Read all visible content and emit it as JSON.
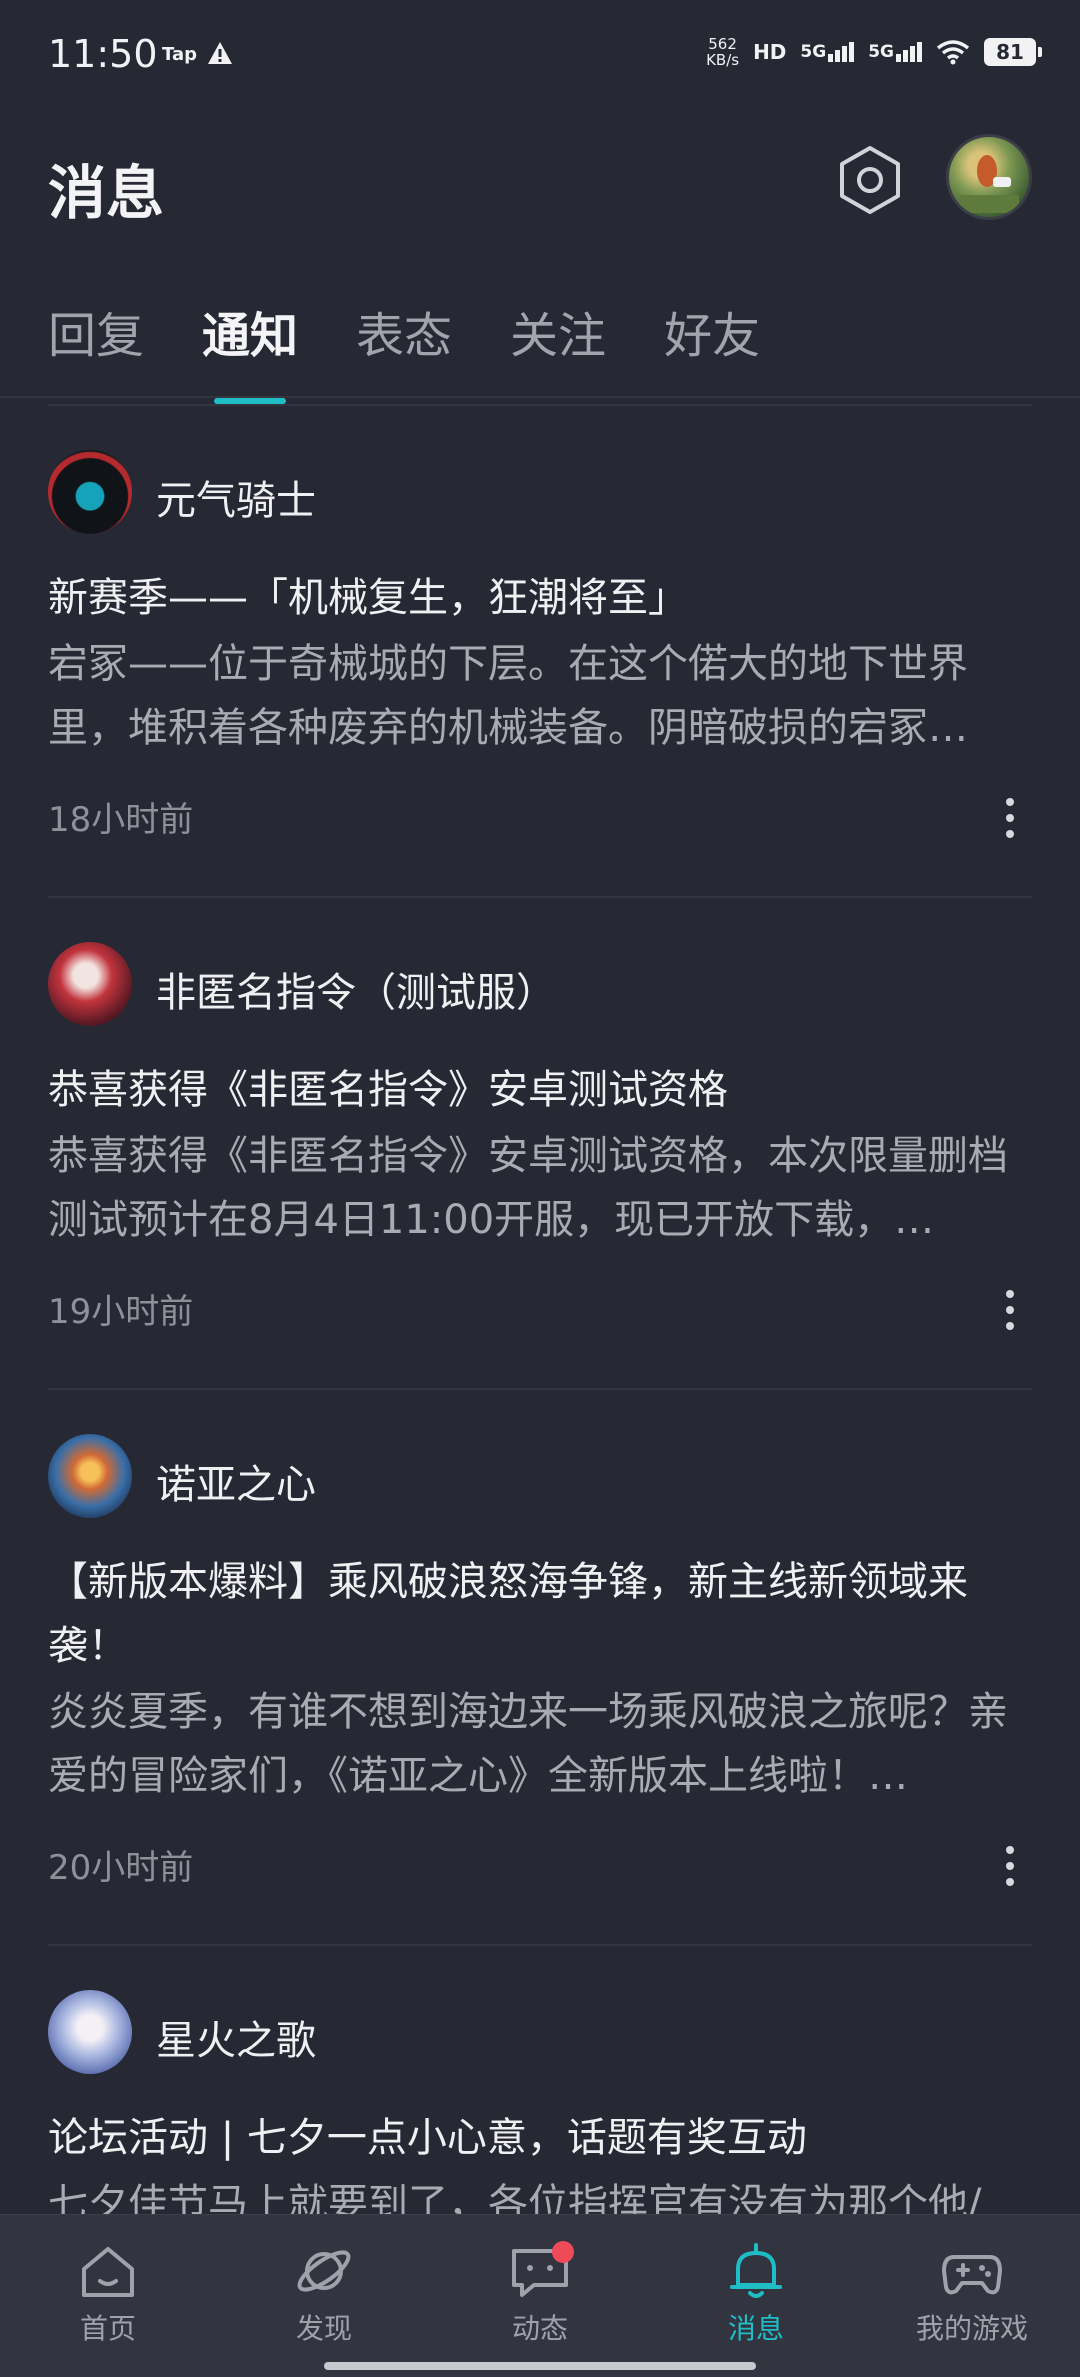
{
  "status_bar": {
    "time": "11:50",
    "tap_badge": "Tap",
    "net_speed_value": "562",
    "net_speed_unit": "KB/s",
    "hd_label": "HD",
    "sim1_label": "5G",
    "sim2_label": "5G",
    "battery": "81"
  },
  "header": {
    "title": "消息",
    "settings_icon": "hexagon-settings-icon",
    "avatar_icon": "user-avatar"
  },
  "tabs": [
    {
      "label": "回复",
      "active": false
    },
    {
      "label": "通知",
      "active": true
    },
    {
      "label": "表态",
      "active": false
    },
    {
      "label": "关注",
      "active": false
    },
    {
      "label": "好友",
      "active": false
    }
  ],
  "notifications": [
    {
      "game": "元气骑士",
      "headline": "新赛季——「机械复生，狂潮将至」",
      "body": "宕冢——位于奇械城的下层。在这个偌大的地下世界里，堆积着各种废弃的机械装备。阴暗破损的宕冢…",
      "time": "18小时前"
    },
    {
      "game": "非匿名指令（测试服）",
      "headline": "恭喜获得《非匿名指令》安卓测试资格",
      "body": "恭喜获得《非匿名指令》安卓测试资格，本次限量删档测试预计在8月4日11:00开服，现已开放下载，…",
      "time": "19小时前"
    },
    {
      "game": "诺亚之心",
      "headline": "【新版本爆料】乘风破浪怒海争锋，新主线新领域来袭！",
      "body": "炎炎夏季，有谁不想到海边来一场乘风破浪之旅呢？亲爱的冒险家们，《诺亚之心》全新版本上线啦！…",
      "time": "20小时前"
    },
    {
      "game": "星火之歌",
      "headline": "论坛活动 | 七夕一点小心意，话题有奖互动",
      "body": "七夕佳节马上就要到了，各位指挥官有没有为那个他/",
      "time": ""
    }
  ],
  "bottom_nav": [
    {
      "label": "首页",
      "icon": "home-icon",
      "active": false
    },
    {
      "label": "发现",
      "icon": "planet-icon",
      "active": false
    },
    {
      "label": "动态",
      "icon": "chat-icon",
      "active": false,
      "badge": true
    },
    {
      "label": "消息",
      "icon": "bell-icon",
      "active": true
    },
    {
      "label": "我的游戏",
      "icon": "gamepad-icon",
      "active": false
    }
  ],
  "colors": {
    "background": "#262833",
    "accent": "#1fbec7",
    "badge_red": "#ef4a57"
  }
}
